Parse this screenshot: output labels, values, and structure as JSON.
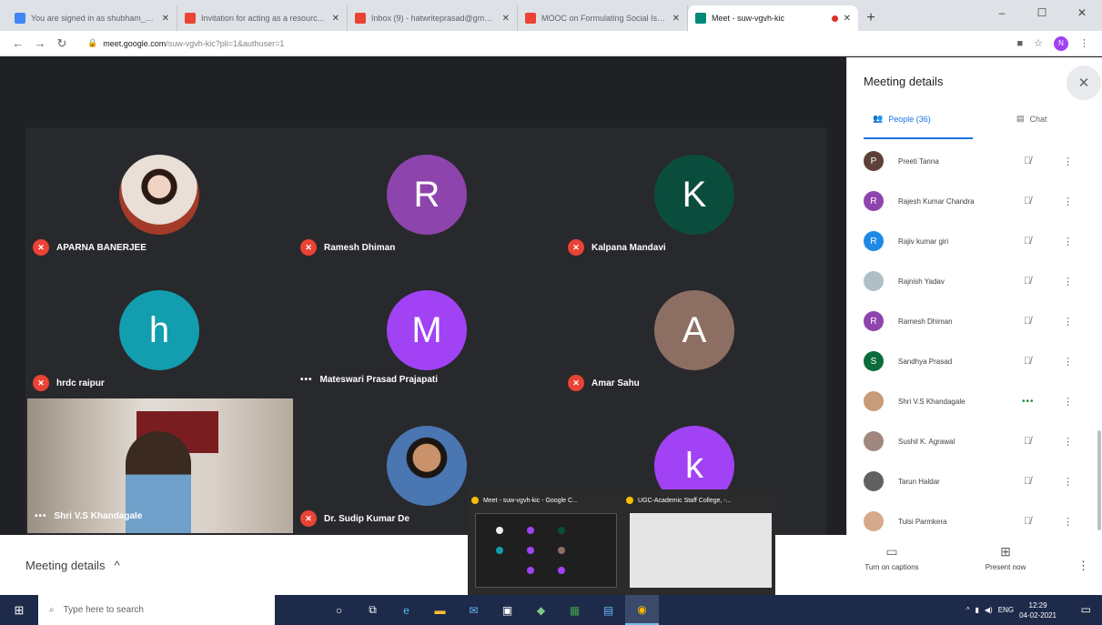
{
  "browser": {
    "tabs": [
      {
        "title": "You are signed in as shubham_1...",
        "favicon_color": "#4285f4"
      },
      {
        "title": "Invitation for acting as a resourc...",
        "favicon_color": "#ea4335"
      },
      {
        "title": "Inbox (9) - hatwriteprasad@gmail...",
        "favicon_color": "#ea4335"
      },
      {
        "title": "MOOC on Formulating Social Issu...",
        "favicon_color": "#ea4335"
      },
      {
        "title": "Meet - suw-vgvh-kic",
        "favicon_color": "#00897b",
        "active": true
      }
    ],
    "new_tab": "+",
    "window_controls": [
      "–",
      "☐",
      "✕"
    ],
    "url_host": "meet.google.com",
    "url_path": "/suw-vgvh-kic?pli=1&authuser=1",
    "profile_initial": "N"
  },
  "meeting": {
    "tiles": [
      {
        "name": "APARNA BANERJEE",
        "initial": "",
        "color": "",
        "photo": true,
        "status": "muted"
      },
      {
        "name": "Ramesh Dhiman",
        "initial": "R",
        "color": "#8e44ad",
        "status": "muted"
      },
      {
        "name": "Kalpana Mandavi",
        "initial": "K",
        "color": "#0b4d3c",
        "status": "muted"
      },
      {
        "name": "hrdc raipur",
        "initial": "h",
        "color": "#129eaf",
        "status": "muted"
      },
      {
        "name": "Mateswari Prasad Prajapati",
        "initial": "M",
        "color": "#a142f4",
        "status": "speaking"
      },
      {
        "name": "Amar Sahu",
        "initial": "A",
        "color": "#8d6e63",
        "status": "muted"
      },
      {
        "name": "Dr. Sudip Kumar De",
        "initial": "",
        "color": "",
        "photo": true,
        "status": "muted"
      },
      {
        "name": "",
        "initial": "k",
        "color": "#a142f4",
        "status": "none"
      }
    ],
    "self_video_name": "Shri V.S Khandagale",
    "details_label": "Meeting details",
    "captions_label": "Turn on captions",
    "present_label": "Present now"
  },
  "panel": {
    "title": "Meeting details",
    "people_tab": "People (36)",
    "chat_tab": "Chat",
    "participants": [
      {
        "name": "Preeti Tanna",
        "initial": "P",
        "color": "#5d4037",
        "mic": "muted"
      },
      {
        "name": "Rajesh Kumar Chandra",
        "initial": "R",
        "color": "#8e44ad",
        "mic": "muted"
      },
      {
        "name": "Rajiv kumar giri",
        "initial": "R",
        "color": "#1e88e5",
        "mic": "muted"
      },
      {
        "name": "Rajnish Yadav",
        "initial": "",
        "color": "#b0bec5",
        "mic": "muted"
      },
      {
        "name": "Ramesh Dhiman",
        "initial": "R",
        "color": "#8e44ad",
        "mic": "muted"
      },
      {
        "name": "Sandhya Prasad",
        "initial": "S",
        "color": "#0b6b3a",
        "mic": "muted"
      },
      {
        "name": "Shri V.S Khandagale",
        "initial": "",
        "color": "#c89b7b",
        "mic": "speaking"
      },
      {
        "name": "Sushil K. Agrawal",
        "initial": "",
        "color": "#a1887f",
        "mic": "muted"
      },
      {
        "name": "Tarun Haldar",
        "initial": "",
        "color": "#616161",
        "mic": "muted"
      },
      {
        "name": "Tulsi Parmkera",
        "initial": "",
        "color": "#d7a98c",
        "mic": "muted"
      }
    ]
  },
  "preview": {
    "left_title": "Meet - suw-vgvh-kic - Google C...",
    "right_title": "UGC-Academic Staff College, -..."
  },
  "taskbar": {
    "search_placeholder": "Type here to search",
    "language": "ENG",
    "time": "12:29",
    "date": "04-02-2021"
  }
}
